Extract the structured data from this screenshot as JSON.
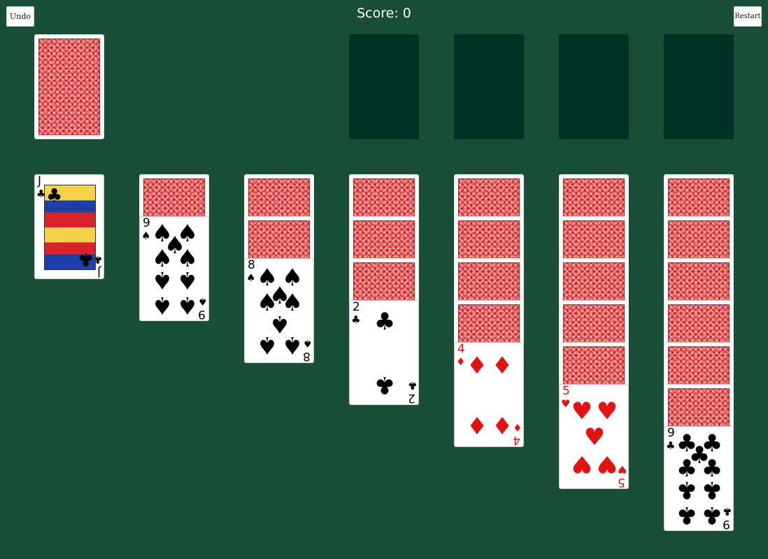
{
  "toolbar": {
    "undo_label": "Undo",
    "restart_label": "Restart"
  },
  "score": {
    "text": "Score: 0"
  },
  "stock": {
    "face_down": true
  },
  "foundations": [
    {
      "empty": true
    },
    {
      "empty": true
    },
    {
      "empty": true
    },
    {
      "empty": true
    }
  ],
  "tableau": [
    {
      "face_down": 0,
      "face_up": [
        {
          "rank": "J",
          "suit": "♣",
          "color": "black"
        }
      ]
    },
    {
      "face_down": 1,
      "face_up": [
        {
          "rank": "9",
          "suit": "♠",
          "color": "black"
        }
      ]
    },
    {
      "face_down": 2,
      "face_up": [
        {
          "rank": "8",
          "suit": "♠",
          "color": "black"
        }
      ]
    },
    {
      "face_down": 3,
      "face_up": [
        {
          "rank": "2",
          "suit": "♣",
          "color": "black"
        }
      ]
    },
    {
      "face_down": 4,
      "face_up": [
        {
          "rank": "4",
          "suit": "♦",
          "color": "red"
        }
      ]
    },
    {
      "face_down": 5,
      "face_up": [
        {
          "rank": "5",
          "suit": "♥",
          "color": "red"
        }
      ]
    },
    {
      "face_down": 6,
      "face_up": [
        {
          "rank": "9",
          "suit": "♣",
          "color": "black"
        }
      ]
    }
  ],
  "colors": {
    "felt": "#174e35",
    "empty_slot": "#003224",
    "red_suit": "#e41313"
  }
}
